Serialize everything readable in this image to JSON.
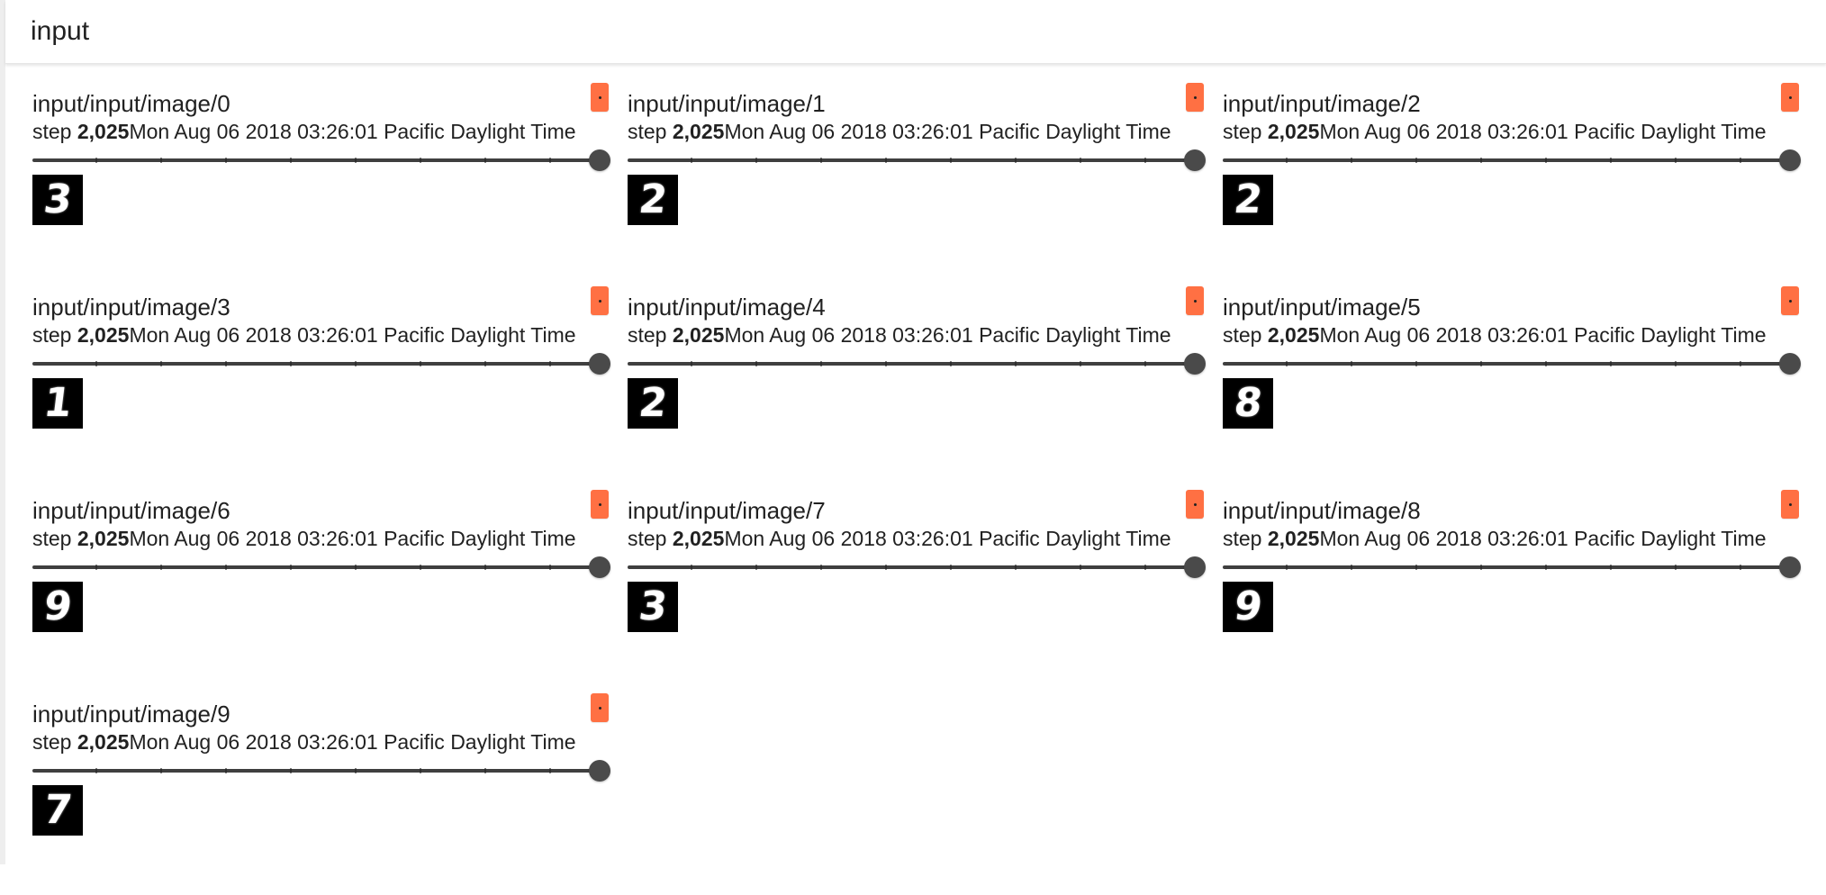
{
  "header": {
    "title": "input"
  },
  "cards": [
    {
      "title": "input/input/image/0",
      "step_label": "step ",
      "step_value": "2,025",
      "timestamp": "Mon Aug 06 2018 03:26:01 Pacific Daylight Time",
      "slider_value": 1.0,
      "digit": "3"
    },
    {
      "title": "input/input/image/1",
      "step_label": "step ",
      "step_value": "2,025",
      "timestamp": "Mon Aug 06 2018 03:26:01 Pacific Daylight Time",
      "slider_value": 1.0,
      "digit": "2"
    },
    {
      "title": "input/input/image/2",
      "step_label": "step ",
      "step_value": "2,025",
      "timestamp": "Mon Aug 06 2018 03:26:01 Pacific Daylight Time",
      "slider_value": 1.0,
      "digit": "2"
    },
    {
      "title": "input/input/image/3",
      "step_label": "step ",
      "step_value": "2,025",
      "timestamp": "Mon Aug 06 2018 03:26:01 Pacific Daylight Time",
      "slider_value": 1.0,
      "digit": "1"
    },
    {
      "title": "input/input/image/4",
      "step_label": "step ",
      "step_value": "2,025",
      "timestamp": "Mon Aug 06 2018 03:26:01 Pacific Daylight Time",
      "slider_value": 1.0,
      "digit": "2"
    },
    {
      "title": "input/input/image/5",
      "step_label": "step ",
      "step_value": "2,025",
      "timestamp": "Mon Aug 06 2018 03:26:01 Pacific Daylight Time",
      "slider_value": 1.0,
      "digit": "8"
    },
    {
      "title": "input/input/image/6",
      "step_label": "step ",
      "step_value": "2,025",
      "timestamp": "Mon Aug 06 2018 03:26:01 Pacific Daylight Time",
      "slider_value": 1.0,
      "digit": "9"
    },
    {
      "title": "input/input/image/7",
      "step_label": "step ",
      "step_value": "2,025",
      "timestamp": "Mon Aug 06 2018 03:26:01 Pacific Daylight Time",
      "slider_value": 1.0,
      "digit": "3"
    },
    {
      "title": "input/input/image/8",
      "step_label": "step ",
      "step_value": "2,025",
      "timestamp": "Mon Aug 06 2018 03:26:01 Pacific Daylight Time",
      "slider_value": 1.0,
      "digit": "9"
    },
    {
      "title": "input/input/image/9",
      "step_label": "step ",
      "step_value": "2,025",
      "timestamp": "Mon Aug 06 2018 03:26:01 Pacific Daylight Time",
      "slider_value": 1.0,
      "digit": "7"
    }
  ],
  "colors": {
    "badge": "#ff7043",
    "slider_thumb": "#4a4a4a",
    "slider_track": "#3f3f3f",
    "thumbnail_background": "#000000"
  },
  "icons": {
    "card_badge": "orange-badge-icon"
  }
}
